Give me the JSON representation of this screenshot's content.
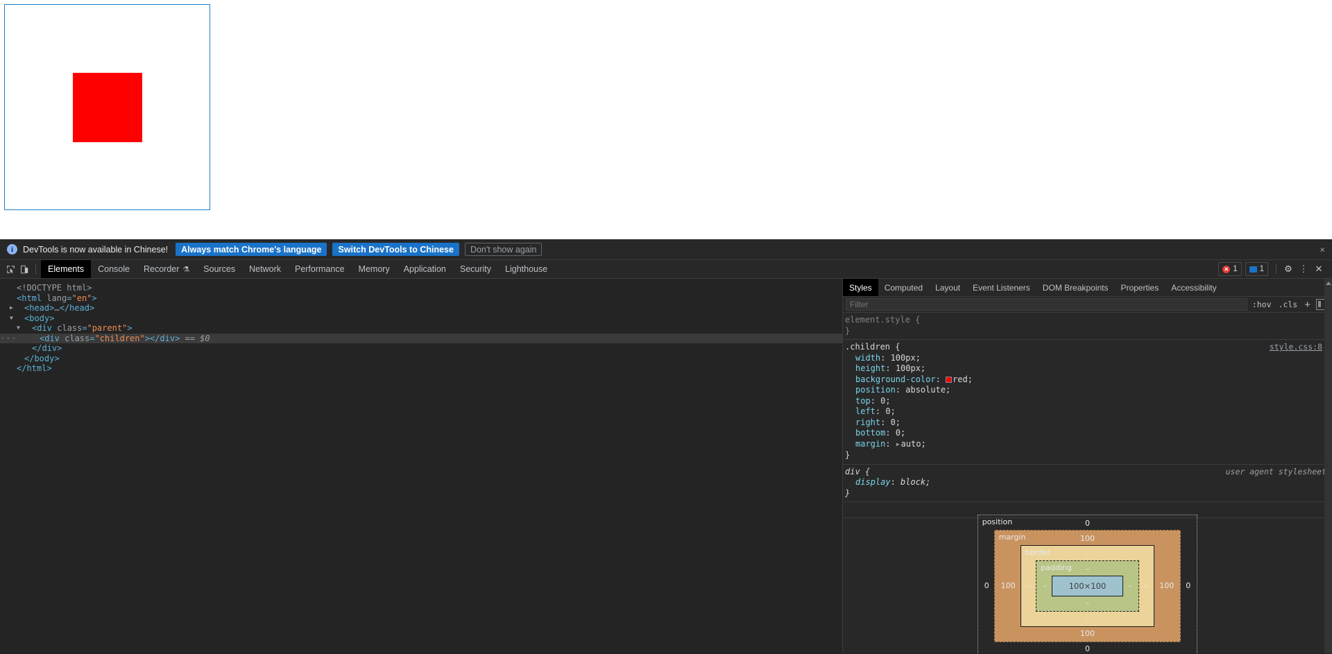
{
  "page": {
    "parent_class": "parent",
    "child_class": "children",
    "child_color": "#ff0000",
    "parent_border_color": "#1a80cb"
  },
  "infobar": {
    "icon": "info-icon",
    "text": "DevTools is now available in Chinese!",
    "buttons": [
      {
        "label": "Always match Chrome's language",
        "style": "primary"
      },
      {
        "label": "Switch DevTools to Chinese",
        "style": "primary"
      },
      {
        "label": "Don't show again",
        "style": "ghost"
      }
    ],
    "close": "×"
  },
  "toolbar": {
    "icons": [
      {
        "name": "inspect-element-icon"
      },
      {
        "name": "device-toolbar-icon"
      }
    ],
    "tabs": [
      {
        "label": "Elements",
        "active": true
      },
      {
        "label": "Console",
        "active": false
      },
      {
        "label": "Recorder",
        "active": false,
        "suffix": "⚗"
      },
      {
        "label": "Sources",
        "active": false
      },
      {
        "label": "Network",
        "active": false
      },
      {
        "label": "Performance",
        "active": false
      },
      {
        "label": "Memory",
        "active": false
      },
      {
        "label": "Application",
        "active": false
      },
      {
        "label": "Security",
        "active": false
      },
      {
        "label": "Lighthouse",
        "active": false
      }
    ],
    "error_count": "1",
    "message_count": "1",
    "settings_icon": "⚙",
    "more_icon": "⋮",
    "close_icon": "✕"
  },
  "dom": {
    "lines": [
      {
        "indent": 0,
        "twisty": "",
        "html": "<span class=\"doct\">&lt;!DOCTYPE html&gt;</span>"
      },
      {
        "indent": 0,
        "twisty": "",
        "html": "<span class=\"tag\">&lt;html </span><span class=\"attrn\">lang</span><span class=\"tag\">=</span><span class=\"attrv\">\"en\"</span><span class=\"tag\">&gt;</span>"
      },
      {
        "indent": 1,
        "twisty": "▶",
        "html": "<span class=\"tag\">&lt;head&gt;</span><span class=\"attr\">…</span><span class=\"tag\">&lt;/head&gt;</span>"
      },
      {
        "indent": 1,
        "twisty": "▼",
        "html": "<span class=\"tag\">&lt;body&gt;</span>"
      },
      {
        "indent": 2,
        "twisty": "▼",
        "html": "<span class=\"tag\">&lt;div </span><span class=\"attrn\">class</span><span class=\"tag\">=</span><span class=\"attrv\">\"parent\"</span><span class=\"tag\">&gt;</span>"
      },
      {
        "indent": 3,
        "twisty": "",
        "selected": true,
        "ellipsis": true,
        "html": "<span class=\"tag\">&lt;div </span><span class=\"attrn\">class</span><span class=\"tag\">=</span><span class=\"attrv\">\"children\"</span><span class=\"tag\">&gt;&lt;/div&gt;</span><span class=\"selvar\"> == $0</span>"
      },
      {
        "indent": 2,
        "twisty": "",
        "html": "<span class=\"tag\">&lt;/div&gt;</span>"
      },
      {
        "indent": 1,
        "twisty": "",
        "html": "<span class=\"tag\">&lt;/body&gt;</span>"
      },
      {
        "indent": 0,
        "twisty": "",
        "html": "<span class=\"tag\">&lt;/html&gt;</span>"
      }
    ]
  },
  "styles": {
    "tabs": [
      {
        "label": "Styles",
        "active": true
      },
      {
        "label": "Computed",
        "active": false
      },
      {
        "label": "Layout",
        "active": false
      },
      {
        "label": "Event Listeners",
        "active": false
      },
      {
        "label": "DOM Breakpoints",
        "active": false
      },
      {
        "label": "Properties",
        "active": false
      },
      {
        "label": "Accessibility",
        "active": false
      }
    ],
    "filter_placeholder": "Filter",
    "filter_value": "",
    "hov_label": ":hov",
    "cls_label": ".cls",
    "plus_label": "+",
    "rules": [
      {
        "selector": "element.style",
        "origin": "",
        "origin_link": "",
        "ua": false,
        "declarations": []
      },
      {
        "selector": ".children",
        "origin": "",
        "origin_link": "style.css:8",
        "ua": false,
        "declarations": [
          {
            "prop": "width",
            "value": "100px"
          },
          {
            "prop": "height",
            "value": "100px"
          },
          {
            "prop": "background-color",
            "value": "red",
            "swatch": "#ff0000"
          },
          {
            "prop": "position",
            "value": "absolute"
          },
          {
            "prop": "top",
            "value": "0"
          },
          {
            "prop": "left",
            "value": "0"
          },
          {
            "prop": "right",
            "value": "0"
          },
          {
            "prop": "bottom",
            "value": "0"
          },
          {
            "prop": "margin",
            "value": "auto",
            "expandable": true
          }
        ]
      },
      {
        "selector": "div",
        "origin": "user agent stylesheet",
        "origin_link": "",
        "ua": true,
        "declarations": [
          {
            "prop": "display",
            "value": "block"
          }
        ]
      }
    ]
  },
  "box_model": {
    "position": {
      "label": "position",
      "top": "0",
      "right": "0",
      "bottom": "0",
      "left": "0"
    },
    "margin": {
      "label": "margin",
      "top": "100",
      "right": "100",
      "bottom": "100",
      "left": "100"
    },
    "border": {
      "label": "border",
      "top": "–",
      "right": "–",
      "bottom": "–",
      "left": "–"
    },
    "padding": {
      "label": "padding",
      "top": "–",
      "right": "–",
      "bottom": "–",
      "left": "–"
    },
    "content": {
      "size": "100×100"
    },
    "colors": {
      "margin": "#c9935f",
      "border": "#ecd39a",
      "padding": "#b9c587",
      "content": "#9fc2cf"
    }
  }
}
